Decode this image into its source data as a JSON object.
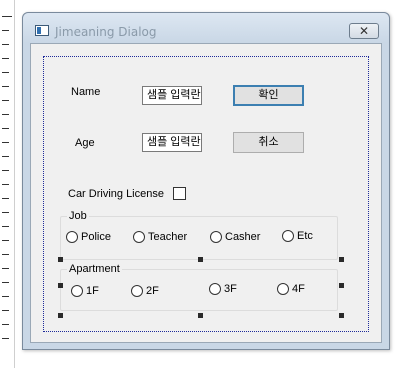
{
  "window": {
    "title": "Jimeaning Dialog",
    "close_label": "✕"
  },
  "form": {
    "name_label": "Name",
    "name_value": "샘플 입력란",
    "age_label": "Age",
    "age_value": "샘플 입력란",
    "license_label": "Car Driving License",
    "license_checked": false
  },
  "buttons": {
    "ok_label": "확인",
    "cancel_label": "취소"
  },
  "job_group": {
    "title": "Job",
    "options": [
      "Police",
      "Teacher",
      "Casher",
      "Etc"
    ]
  },
  "apartment_group": {
    "title": "Apartment",
    "options": [
      "1F",
      "2F",
      "3F",
      "4F"
    ]
  },
  "colors": {
    "default_button_border": "#3c7fb1",
    "selection_frame": "#1e2a9a",
    "dialog_background": "#f0f0f0"
  }
}
